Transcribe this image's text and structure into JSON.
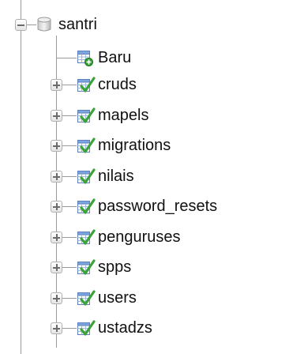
{
  "tree": {
    "database": {
      "label": "santri",
      "expanded": true
    },
    "new_item": {
      "label": "Baru"
    },
    "tables": [
      {
        "label": "cruds",
        "expanded": false
      },
      {
        "label": "mapels",
        "expanded": false
      },
      {
        "label": "migrations",
        "expanded": false
      },
      {
        "label": "nilais",
        "expanded": false
      },
      {
        "label": "password_resets",
        "expanded": false
      },
      {
        "label": "penguruses",
        "expanded": false
      },
      {
        "label": "spps",
        "expanded": false
      },
      {
        "label": "users",
        "expanded": false
      },
      {
        "label": "ustadzs",
        "expanded": false
      }
    ]
  },
  "icons": {
    "database": "database-icon",
    "new": "new-table-icon",
    "table": "table-icon"
  },
  "colors": {
    "tree_line": "#9a9a9a",
    "table_icon_blue": "#4a7fd1",
    "check_green": "#3aa33a",
    "new_plus_green": "#2e9e2e"
  }
}
